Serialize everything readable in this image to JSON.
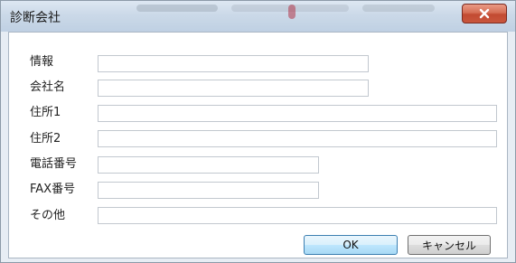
{
  "window": {
    "title": "診断会社"
  },
  "form": {
    "fields": [
      {
        "label": "情報",
        "value": ""
      },
      {
        "label": "会社名",
        "value": ""
      },
      {
        "label": "住所1",
        "value": ""
      },
      {
        "label": "住所2",
        "value": ""
      },
      {
        "label": "電話番号",
        "value": ""
      },
      {
        "label": "FAX番号",
        "value": ""
      },
      {
        "label": "その他",
        "value": ""
      }
    ]
  },
  "buttons": {
    "ok": "OK",
    "cancel": "キャンセル"
  },
  "colors": {
    "titlebar": "#cbd9e8",
    "close_button": "#c24a31",
    "default_button_border": "#3c7fb1"
  },
  "icons": {
    "close": "close-icon"
  }
}
